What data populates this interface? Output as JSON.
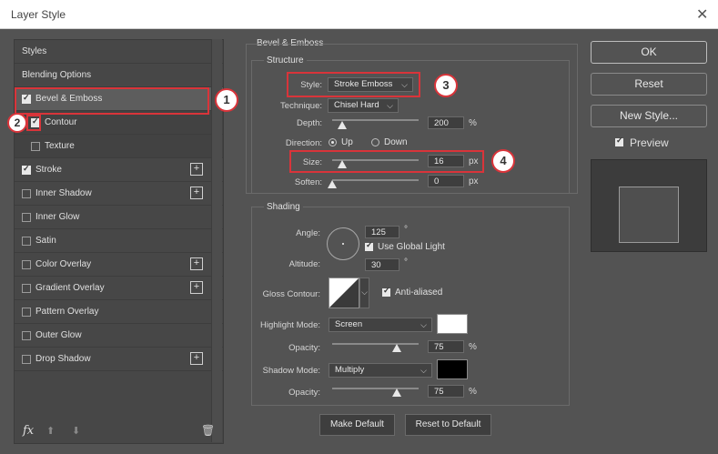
{
  "window": {
    "title": "Layer Style",
    "close_glyph": "✕"
  },
  "sidebar": {
    "items": [
      {
        "label": "Styles",
        "checkbox": false,
        "checked": false,
        "plus": false
      },
      {
        "label": "Blending Options",
        "checkbox": false,
        "checked": false,
        "plus": false
      },
      {
        "label": "Bevel & Emboss",
        "checkbox": true,
        "checked": true,
        "plus": false,
        "selected": true
      },
      {
        "label": "Contour",
        "checkbox": true,
        "checked": true,
        "plus": false,
        "sub": true
      },
      {
        "label": "Texture",
        "checkbox": true,
        "checked": false,
        "plus": false,
        "sub": true
      },
      {
        "label": "Stroke",
        "checkbox": true,
        "checked": true,
        "plus": true
      },
      {
        "label": "Inner Shadow",
        "checkbox": true,
        "checked": false,
        "plus": true
      },
      {
        "label": "Inner Glow",
        "checkbox": true,
        "checked": false,
        "plus": false
      },
      {
        "label": "Satin",
        "checkbox": true,
        "checked": false,
        "plus": false
      },
      {
        "label": "Color Overlay",
        "checkbox": true,
        "checked": false,
        "plus": true
      },
      {
        "label": "Gradient Overlay",
        "checkbox": true,
        "checked": false,
        "plus": true
      },
      {
        "label": "Pattern Overlay",
        "checkbox": true,
        "checked": false,
        "plus": false
      },
      {
        "label": "Outer Glow",
        "checkbox": true,
        "checked": false,
        "plus": false
      },
      {
        "label": "Drop Shadow",
        "checkbox": true,
        "checked": false,
        "plus": true
      }
    ],
    "plus_glyph": "+",
    "fx_label": "fx",
    "up_glyph": "⬆",
    "down_glyph": "⬇",
    "trash_glyph": "🗑"
  },
  "bevel": {
    "heading": "Bevel & Emboss",
    "structure": {
      "heading": "Structure",
      "style_label": "Style:",
      "style_value": "Stroke Emboss",
      "technique_label": "Technique:",
      "technique_value": "Chisel Hard",
      "depth_label": "Depth:",
      "depth_value": "200",
      "depth_unit": "%",
      "depth_level": 0.12,
      "direction_label": "Direction:",
      "direction_up": "Up",
      "direction_down": "Down",
      "size_label": "Size:",
      "size_value": "16",
      "size_unit": "px",
      "size_level": 0.12,
      "soften_label": "Soften:",
      "soften_value": "0",
      "soften_unit": "px",
      "soften_level": 0.0
    },
    "shading": {
      "heading": "Shading",
      "angle_label": "Angle:",
      "angle_value": "125",
      "angle_unit": "°",
      "global_light_label": "Use Global Light",
      "altitude_label": "Altitude:",
      "altitude_value": "30",
      "altitude_unit": "°",
      "gloss_label": "Gloss Contour:",
      "anti_aliased_label": "Anti-aliased",
      "highlight_mode_label": "Highlight Mode:",
      "highlight_mode_value": "Screen",
      "highlight_color": "#ffffff",
      "highlight_opacity_label": "Opacity:",
      "highlight_opacity_value": "75",
      "highlight_opacity_unit": "%",
      "highlight_opacity_level": 0.75,
      "shadow_mode_label": "Shadow Mode:",
      "shadow_mode_value": "Multiply",
      "shadow_color": "#000000",
      "shadow_opacity_label": "Opacity:",
      "shadow_opacity_value": "75",
      "shadow_opacity_unit": "%",
      "shadow_opacity_level": 0.75
    },
    "make_default": "Make Default",
    "reset_default": "Reset to Default"
  },
  "buttons": {
    "ok": "OK",
    "reset": "Reset",
    "new_style": "New Style...",
    "preview": "Preview"
  },
  "annotations": [
    "1",
    "2",
    "3",
    "4"
  ],
  "colors": {
    "accent_red": "#d9343a",
    "panel": "#535353"
  }
}
